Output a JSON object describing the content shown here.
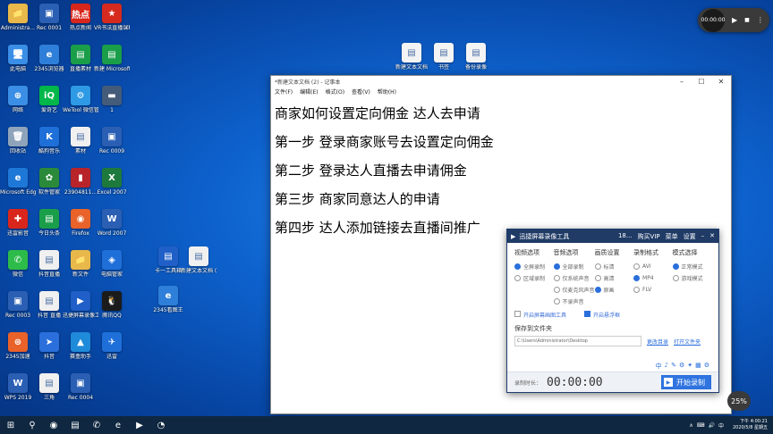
{
  "desktop_icons": [
    {
      "label": "Administra...",
      "glyph": "📁",
      "color": "#e8b84a"
    },
    {
      "label": "Rec 0001",
      "glyph": "▣",
      "color": "#2a5fb4"
    },
    {
      "label": "热点新闻",
      "glyph": "热点",
      "color": "#d9261c"
    },
    {
      "label": "VR书法直播课程设计",
      "glyph": "★",
      "color": "#d62a1f"
    },
    {
      "label": "此电脑",
      "glyph": "🖥",
      "color": "#3a8ee6"
    },
    {
      "label": "2345浏览器",
      "glyph": "e",
      "color": "#2e7fd9"
    },
    {
      "label": "直播素材",
      "glyph": "▤",
      "color": "#1a9e4a"
    },
    {
      "label": "新建 Microsoft...",
      "glyph": "▤",
      "color": "#1a9e4a"
    },
    {
      "label": "网络",
      "glyph": "⊕",
      "color": "#3a8ee6"
    },
    {
      "label": "爱奇艺",
      "glyph": "iQ",
      "color": "#00b74a"
    },
    {
      "label": "WeTool 微信管理",
      "glyph": "⚙",
      "color": "#2e9ae6"
    },
    {
      "label": "1",
      "glyph": "▬",
      "color": "#445b7a"
    },
    {
      "label": "回收站",
      "glyph": "🗑",
      "color": "#8fa4bb"
    },
    {
      "label": "酷狗音乐",
      "glyph": "K",
      "color": "#1f6fd9"
    },
    {
      "label": "素材",
      "glyph": "▤",
      "color": "#f0f0f0"
    },
    {
      "label": "Rec 0009",
      "glyph": "▣",
      "color": "#2a5fb4"
    },
    {
      "label": "Microsoft Edge",
      "glyph": "e",
      "color": "#1e78d8"
    },
    {
      "label": "软件管家",
      "glyph": "✿",
      "color": "#2a8a3a"
    },
    {
      "label": "23904811...",
      "glyph": "▮",
      "color": "#b8242a"
    },
    {
      "label": "Excel 2007",
      "glyph": "X",
      "color": "#1d7a3c"
    },
    {
      "label": "迅雷影音",
      "glyph": "✚",
      "color": "#d9261c"
    },
    {
      "label": "今日头条",
      "glyph": "▤",
      "color": "#1a9e4a"
    },
    {
      "label": "Firefox",
      "glyph": "◉",
      "color": "#e8622a"
    },
    {
      "label": "Word 2007",
      "glyph": "W",
      "color": "#2a5fb4"
    },
    {
      "label": "微信",
      "glyph": "✆",
      "color": "#2dbb4a"
    },
    {
      "label": "抖音直播",
      "glyph": "▤",
      "color": "#f0f0f0"
    },
    {
      "label": "新文件",
      "glyph": "📁",
      "color": "#e8b84a"
    },
    {
      "label": "电脑管家",
      "glyph": "◈",
      "color": "#1f6fd9"
    },
    {
      "label": "Rec 0003",
      "glyph": "▣",
      "color": "#2a5fb4"
    },
    {
      "label": "抖音 直播",
      "glyph": "▤",
      "color": "#f0f0f0"
    },
    {
      "label": "迅捷屏幕录像工具",
      "glyph": "▶",
      "color": "#1f5fc7"
    },
    {
      "label": "腾讯QQ",
      "glyph": "🐧",
      "color": "#1b1b1b"
    },
    {
      "label": "2345加速",
      "glyph": "⊛",
      "color": "#e8622a"
    },
    {
      "label": "抖音",
      "glyph": "➤",
      "color": "#2a6fdb"
    },
    {
      "label": "赛盒助手",
      "glyph": "▲",
      "color": "#1f8ad9"
    },
    {
      "label": "迅雷",
      "glyph": "✈",
      "color": "#1f6fd9"
    },
    {
      "label": "WPS 2019",
      "glyph": "W",
      "color": "#2a5fb4"
    },
    {
      "label": "三角",
      "glyph": "▤",
      "color": "#f0f0f0"
    },
    {
      "label": "Rec 0004",
      "glyph": "▣",
      "color": "#2a5fb4"
    }
  ],
  "extra_icons": [
    {
      "label": "卡一工具箱",
      "glyph": "▤",
      "color": "#1f5fc7"
    },
    {
      "label": "新建文本文档 (2)",
      "glyph": "▤",
      "color": "#f0f0f0"
    },
    {
      "label": "2345看图王",
      "glyph": "e",
      "color": "#2e7fd9"
    }
  ],
  "top_icons": [
    {
      "label": "新建文本文档",
      "glyph": "▤",
      "color": "#f4f4f4"
    },
    {
      "label": "书签",
      "glyph": "▤",
      "color": "#f4f4f4"
    },
    {
      "label": "备份录像",
      "glyph": "▤",
      "color": "#f4f4f4"
    }
  ],
  "notepad": {
    "title": "*新建文本文档 (2) - 记事本",
    "menu": [
      "文件(F)",
      "编辑(E)",
      "格式(O)",
      "查看(V)",
      "帮助(H)"
    ],
    "lines": [
      "商家如何设置定向佣金 达人去申请",
      "第一步 登录商家账号去设置定向佣金",
      "第二步 登录达人直播去申请佣金",
      "第三步 商家同意达人的申请",
      "第四步 达人添加链接去直播间推广"
    ]
  },
  "recorder": {
    "title": "迅捷屏幕录像工具",
    "head_right": [
      "18...",
      "购买VIP",
      "菜单",
      "设置"
    ],
    "columns": [
      {
        "header": "视频选项",
        "options": [
          {
            "label": "全屏录制",
            "on": true
          },
          {
            "label": "区域录制",
            "on": false
          }
        ]
      },
      {
        "header": "音频选项",
        "options": [
          {
            "label": "全部录制",
            "on": true
          },
          {
            "label": "仅系统声音",
            "on": false
          },
          {
            "label": "仅麦克风声音",
            "on": false
          },
          {
            "label": "不录声音",
            "on": false
          }
        ]
      },
      {
        "header": "画质设置",
        "options": [
          {
            "label": "标清",
            "on": false
          },
          {
            "label": "高清",
            "on": false
          },
          {
            "label": "原画",
            "on": true
          }
        ]
      },
      {
        "header": "录制格式",
        "options": [
          {
            "label": "AVI",
            "on": false
          },
          {
            "label": "MP4",
            "on": true
          },
          {
            "label": "FLV",
            "on": false
          }
        ]
      },
      {
        "header": "模式选择",
        "options": [
          {
            "label": "正常模式",
            "on": true
          },
          {
            "label": "游戏模式",
            "on": false
          }
        ]
      }
    ],
    "check_left": "开启屏幕画图工具",
    "check_right": "开启悬浮框",
    "path_title": "保存到文件夹",
    "path": "C:\\Users\\Administrator\\Desktop",
    "change_dir": "更改目录",
    "open_file": "打开文件夹",
    "time_label": "录制时长：",
    "time": "00:00:00",
    "start": "开始录制",
    "mini_toolbar": [
      "中",
      "♪",
      "✎",
      "⚙",
      "✦",
      "▦",
      "⚙"
    ]
  },
  "player": {
    "time": "00:00:00"
  },
  "zoom": "25%",
  "taskbar": {
    "icons": [
      "⊞",
      "⚲",
      "◉",
      "▤",
      "✆",
      "e",
      "▶",
      "◔"
    ],
    "tray": [
      "∧",
      "⌨",
      "🔊",
      "中"
    ],
    "time": "下午 4:00:21",
    "date": "2020/5/8 星期五"
  }
}
